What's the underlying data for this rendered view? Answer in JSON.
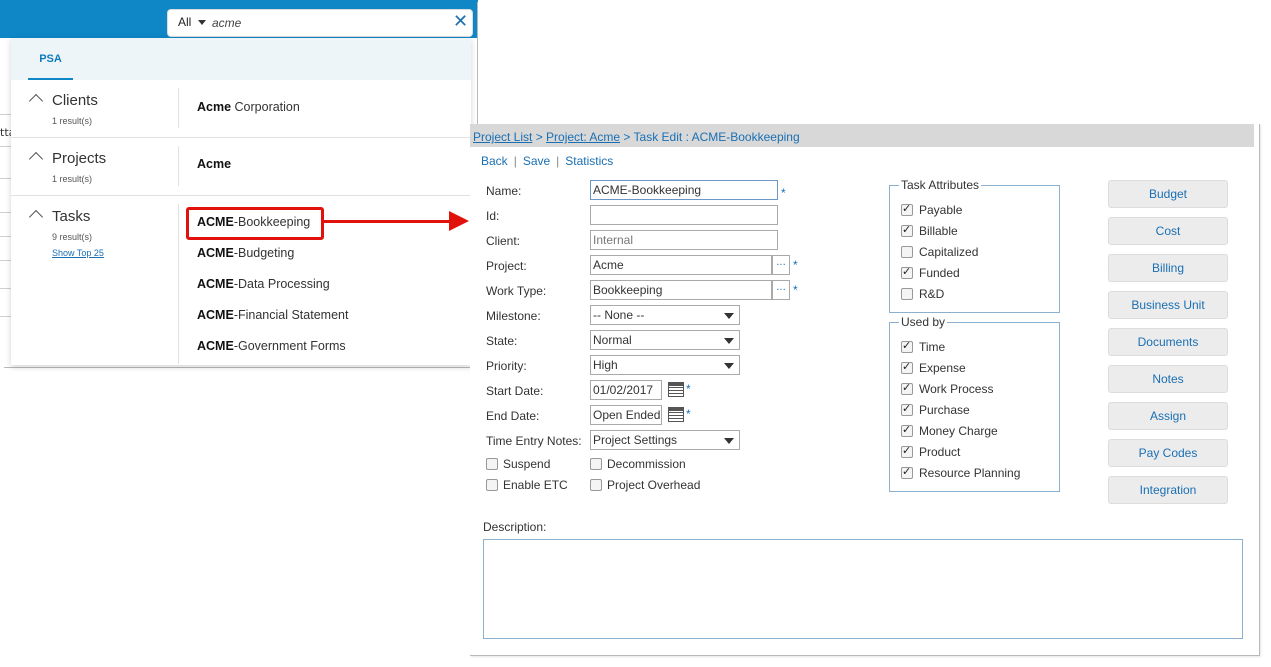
{
  "search": {
    "scope": "All",
    "query": "acme",
    "clear": "✕",
    "tabs": [
      "PSA"
    ],
    "sections": [
      {
        "title": "Clients",
        "count": "1 result(s)",
        "results": [
          {
            "bold": "Acme",
            "rest": " Corporation"
          }
        ]
      },
      {
        "title": "Projects",
        "count": "1 result(s)",
        "results": [
          {
            "bold": "Acme",
            "rest": ""
          }
        ]
      },
      {
        "title": "Tasks",
        "count": "9 result(s)",
        "link": "Show Top 25",
        "results": [
          {
            "bold": "ACME",
            "rest": "-Bookkeeping"
          },
          {
            "bold": "ACME",
            "rest": "-Budgeting"
          },
          {
            "bold": "ACME",
            "rest": "-Data Processing"
          },
          {
            "bold": "ACME",
            "rest": "-Financial Statement"
          },
          {
            "bold": "ACME",
            "rest": "-Government Forms"
          }
        ]
      }
    ],
    "bg_fragment": "tta"
  },
  "edit": {
    "breadcrumb": {
      "project_list": "Project List",
      "sep1": " > ",
      "project": "Project: Acme",
      "sep2": " > ",
      "current": "Task Edit : ACME-Bookkeeping"
    },
    "toolbar": {
      "back": "Back",
      "save": "Save",
      "statistics": "Statistics",
      "sep": "|"
    },
    "fields": {
      "name_label": "Name:",
      "name": "ACME-Bookkeeping",
      "id_label": "Id:",
      "id": "",
      "client_label": "Client:",
      "client": "Internal",
      "project_label": "Project:",
      "project": "Acme",
      "worktype_label": "Work Type:",
      "worktype": "Bookkeeping",
      "milestone_label": "Milestone:",
      "milestone": "-- None --",
      "state_label": "State:",
      "state": "Normal",
      "priority_label": "Priority:",
      "priority": "High",
      "start_label": "Start Date:",
      "start": "01/02/2017",
      "end_label": "End Date:",
      "end": "Open Ended",
      "ten_label": "Time Entry Notes:",
      "ten": "Project Settings",
      "dots": "...",
      "req": "*"
    },
    "checks": {
      "suspend": "Suspend",
      "suspend_on": false,
      "decommission": "Decommission",
      "decommission_on": false,
      "enable_etc": "Enable ETC",
      "enable_etc_on": false,
      "project_overhead": "Project Overhead",
      "project_overhead_on": false
    },
    "task_attributes": {
      "legend": "Task Attributes",
      "items": [
        {
          "label": "Payable",
          "checked": true
        },
        {
          "label": "Billable",
          "checked": true
        },
        {
          "label": "Capitalized",
          "checked": false
        },
        {
          "label": "Funded",
          "checked": true
        },
        {
          "label": "R&D",
          "checked": false
        }
      ]
    },
    "used_by": {
      "legend": "Used by",
      "items": [
        {
          "label": "Time",
          "checked": true
        },
        {
          "label": "Expense",
          "checked": true
        },
        {
          "label": "Work Process",
          "checked": true
        },
        {
          "label": "Purchase",
          "checked": true
        },
        {
          "label": "Money Charge",
          "checked": true
        },
        {
          "label": "Product",
          "checked": true
        },
        {
          "label": "Resource Planning",
          "checked": true
        }
      ]
    },
    "side_buttons": [
      "Budget",
      "Cost",
      "Billing",
      "Business Unit",
      "Documents",
      "Notes",
      "Assign",
      "Pay Codes",
      "Integration"
    ],
    "description_label": "Description:",
    "description": ""
  },
  "colors": {
    "accent": "#0f86c6",
    "link": "#1a6fb3",
    "annotation": "#e0120b"
  }
}
